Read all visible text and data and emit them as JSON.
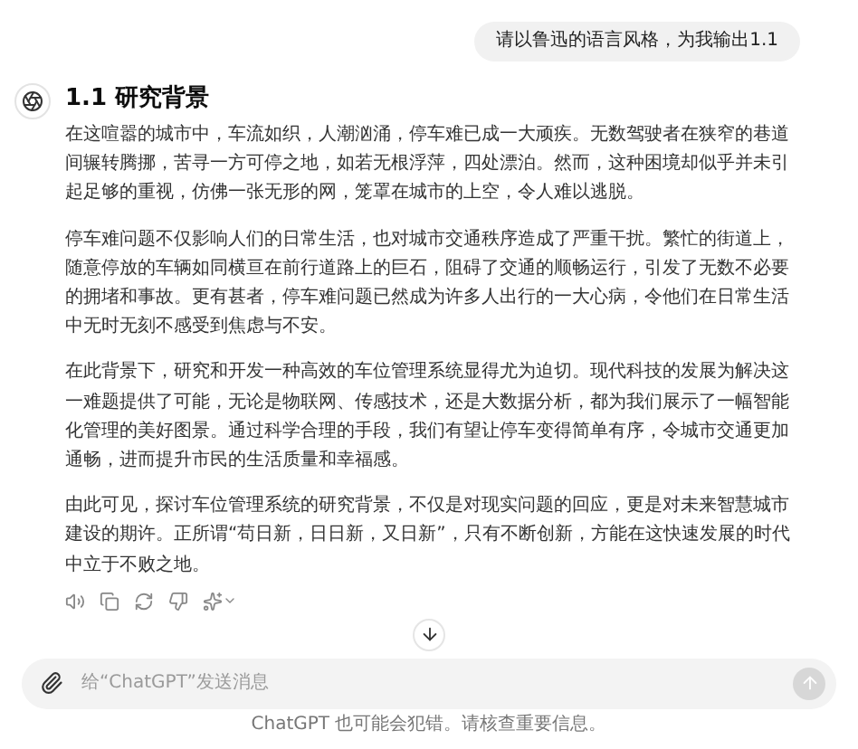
{
  "user_message": "请以鲁迅的语言风格，为我输出1.1",
  "reply": {
    "heading": "1.1 研究背景",
    "paragraphs": [
      "在这喧嚣的城市中，车流如织，人潮汹涌，停车难已成一大顽疾。无数驾驶者在狭窄的巷道间辗转腾挪，苦寻一方可停之地，如若无根浮萍，四处漂泊。然而，这种困境却似乎并未引起足够的重视，仿佛一张无形的网，笼罩在城市的上空，令人难以逃脱。",
      "停车难问题不仅影响人们的日常生活，也对城市交通秩序造成了严重干扰。繁忙的街道上，随意停放的车辆如同横亘在前行道路上的巨石，阻碍了交通的顺畅运行，引发了无数不必要的拥堵和事故。更有甚者，停车难问题已然成为许多人出行的一大心病，令他们在日常生活中无时无刻不感受到焦虑与不安。",
      "在此背景下，研究和开发一种高效的车位管理系统显得尤为迫切。现代科技的发展为解决这一难题提供了可能，无论是物联网、传感技术，还是大数据分析，都为我们展示了一幅智能化管理的美好图景。通过科学合理的手段，我们有望让停车变得简单有序，令城市交通更加通畅，进而提升市民的生活质量和幸福感。",
      "由此可见，探讨车位管理系统的研究背景，不仅是对现实问题的回应，更是对未来智慧城市建设的期许。正所谓“苟日新，日日新，又日新”，只有不断创新，方能在这快速发展的时代中立于不败之地。"
    ]
  },
  "composer": {
    "placeholder": "给“ChatGPT”发送消息",
    "send_enabled": false
  },
  "footer": "ChatGPT 也可能会犯错。请核查重要信息。"
}
